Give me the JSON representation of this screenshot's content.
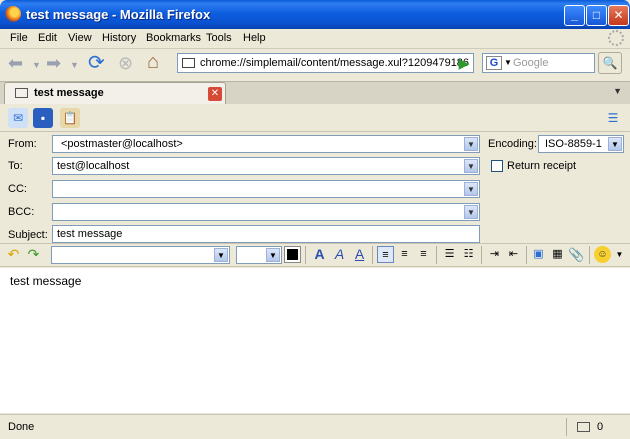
{
  "window": {
    "title": "test message - Mozilla Firefox"
  },
  "menu": [
    "File",
    "Edit",
    "View",
    "History",
    "Bookmarks",
    "Tools",
    "Help"
  ],
  "nav": {
    "url": "chrome://simplemail/content/message.xul?1209479186",
    "search_placeholder": "Google",
    "search_engine_letter": "G"
  },
  "tab": {
    "title": "test message"
  },
  "compose": {
    "from_label": "From:",
    "from_value": "<postmaster@localhost>",
    "to_label": "To:",
    "to_value": "test@localhost",
    "cc_label": "CC:",
    "cc_value": "",
    "bcc_label": "BCC:",
    "bcc_value": "",
    "subject_label": "Subject:",
    "subject_value": "test message",
    "encoding_label": "Encoding:",
    "encoding_value": "ISO-8859-1",
    "return_receipt_label": "Return receipt",
    "body": "test message"
  },
  "status": {
    "text": "Done",
    "count": "0"
  }
}
